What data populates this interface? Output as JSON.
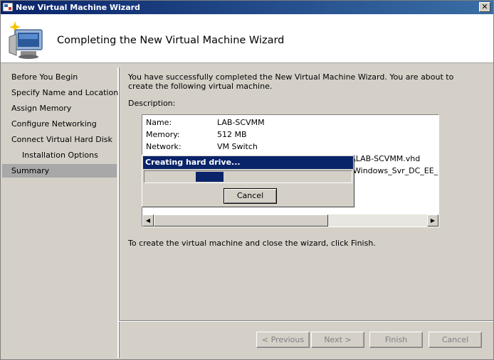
{
  "window": {
    "title": "New Virtual Machine Wizard",
    "close_glyph": "✕",
    "app_icon": "vm-wizard-icon"
  },
  "header": {
    "title": "Completing the New Virtual Machine Wizard",
    "icon": "computer-sparkle-icon"
  },
  "nav": {
    "items": [
      {
        "label": "Before You Begin"
      },
      {
        "label": "Specify Name and Location"
      },
      {
        "label": "Assign Memory"
      },
      {
        "label": "Configure Networking"
      },
      {
        "label": "Connect Virtual Hard Disk"
      },
      {
        "label": "Installation Options"
      },
      {
        "label": "Summary",
        "selected": true
      }
    ]
  },
  "main": {
    "intro": "You have successfully completed the New Virtual Machine Wizard. You are about to create the following virtual machine.",
    "description_label": "Description:",
    "description": [
      {
        "key": "Name:",
        "value": "LAB-SCVMM"
      },
      {
        "key": "Memory:",
        "value": "512 MB"
      },
      {
        "key": "Network:",
        "value": "VM Switch"
      }
    ],
    "hidden_fragments": [
      "\\LAB-SCVMM.vhd",
      "Windows_Svr_DC_EE_SE"
    ],
    "finish_text": "To create the virtual machine and close the wizard, click Finish."
  },
  "progress": {
    "title": "Creating hard drive...",
    "cancel_label": "Cancel",
    "level": 0.13
  },
  "buttons": {
    "previous": "< Previous",
    "next": "Next >",
    "finish": "Finish",
    "cancel": "Cancel"
  },
  "colors": {
    "titlebar": "#0a246a",
    "face": "#d4d0c8",
    "selected_nav": "#a8a8a8"
  }
}
